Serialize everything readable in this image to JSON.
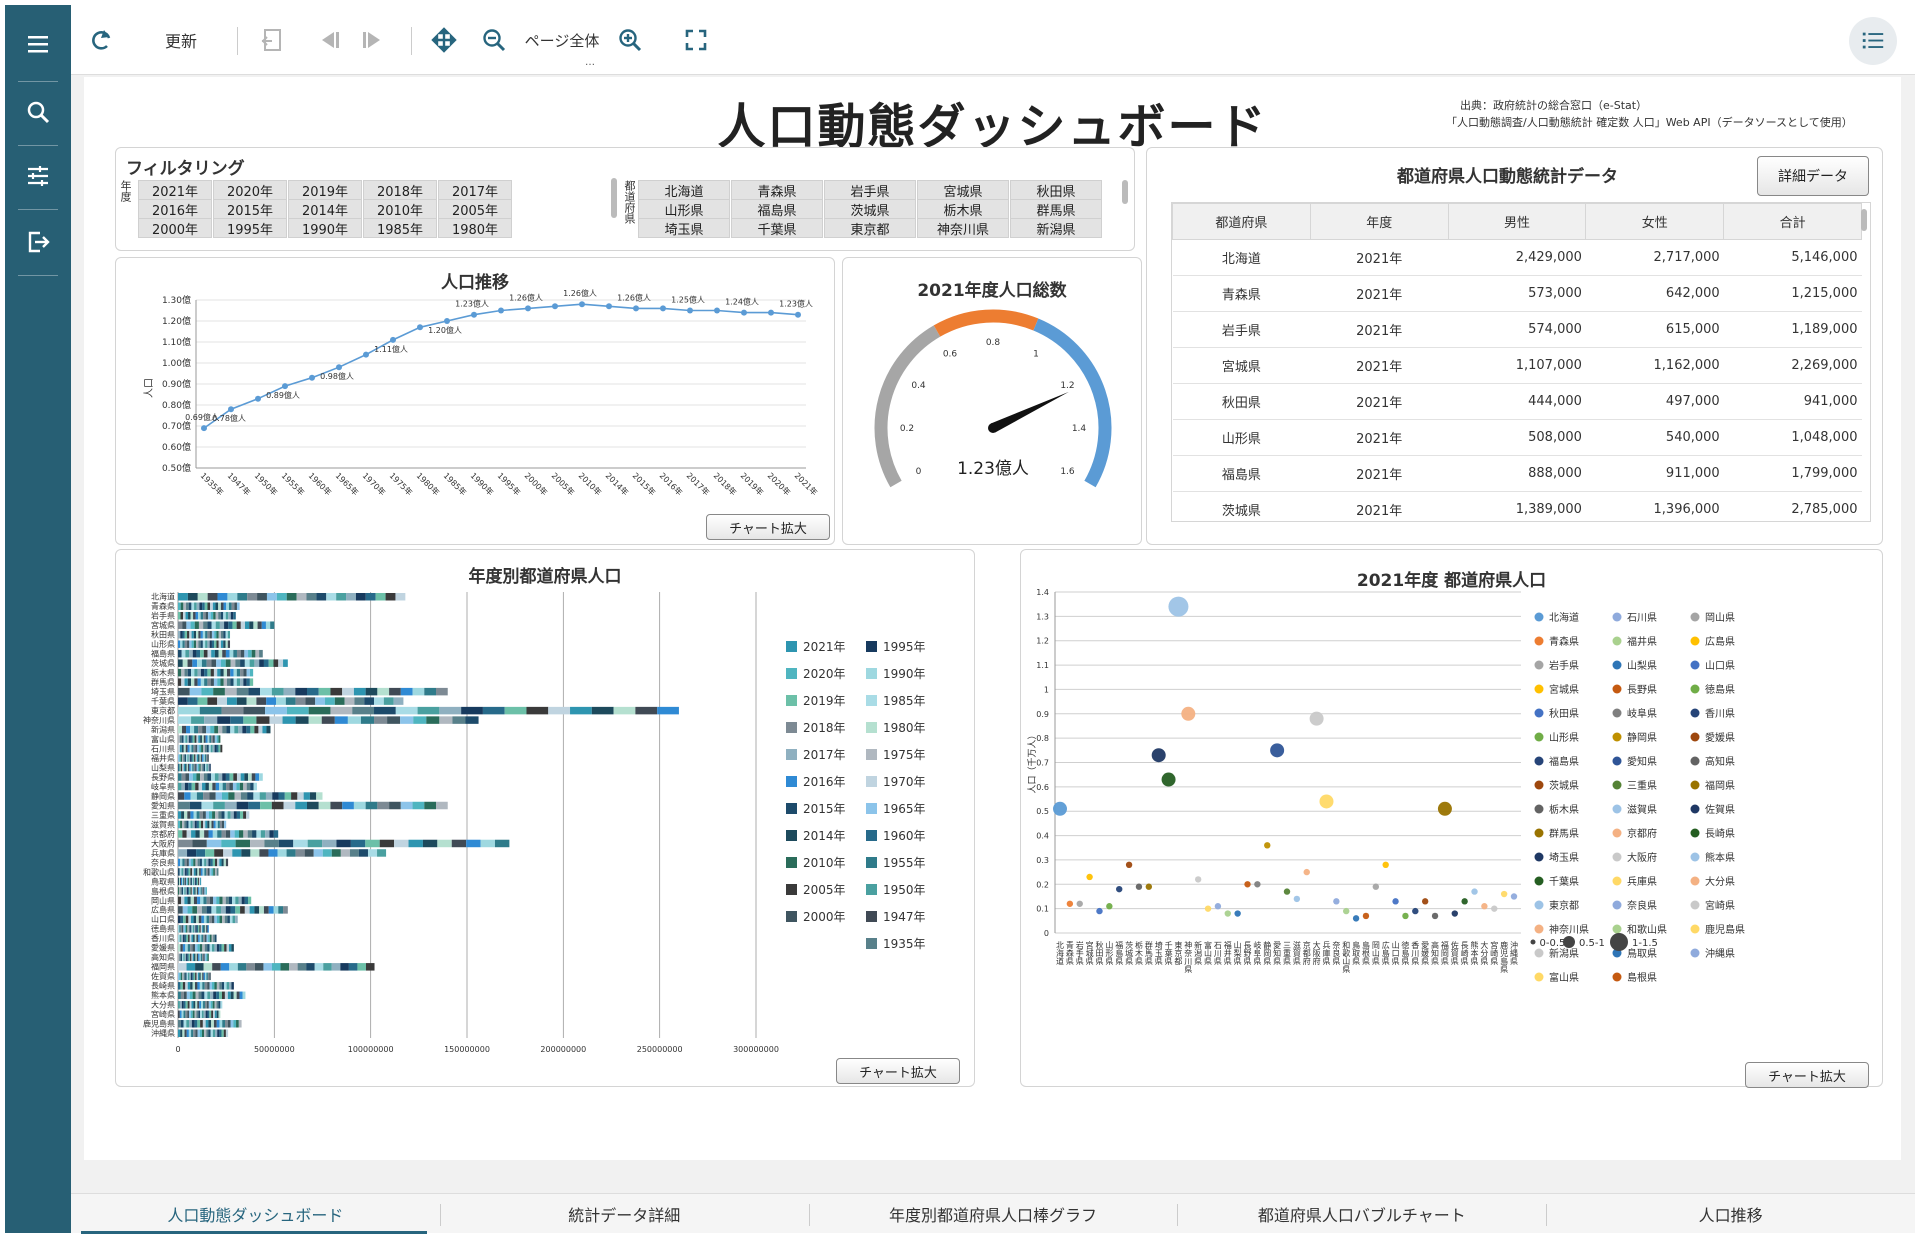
{
  "toolbar": {
    "refresh_label": "更新",
    "page_fit_label": "ページ全体"
  },
  "dashboard": {
    "title": "人口動態ダッシュボード",
    "source_line1": "出典：政府統計の総合窓口（e-Stat）",
    "source_line2": "「人口動態調査/人口動態統計 確定数 人口」Web API（データソースとして使用）"
  },
  "filter": {
    "title": "フィルタリング",
    "year_label": "年度",
    "pref_label": "都道府県",
    "years": [
      "2021年",
      "2020年",
      "2019年",
      "2018年",
      "2017年",
      "2016年",
      "2015年",
      "2014年",
      "2010年",
      "2005年",
      "2000年",
      "1995年",
      "1990年",
      "1985年",
      "1980年"
    ],
    "prefs": [
      "北海道",
      "青森県",
      "岩手県",
      "宮城県",
      "秋田県",
      "山形県",
      "福島県",
      "茨城県",
      "栃木県",
      "群馬県",
      "埼玉県",
      "千葉県",
      "東京都",
      "神奈川県",
      "新潟県"
    ]
  },
  "line_panel": {
    "title": "人口推移",
    "ylabel": "人口",
    "expand_label": "チャート拡大"
  },
  "gauge_panel": {
    "title": "2021年度人口総数",
    "value_label": "1.23億人",
    "value": 1.23,
    "min": 0,
    "max": 1.6,
    "ticks": [
      "0",
      "0.2",
      "0.4",
      "0.6",
      "0.8",
      "1",
      "1.2",
      "1.4",
      "1.6"
    ],
    "colors": {
      "low": "#a6a6a6",
      "mid": "#ed7d31",
      "high": "#5b9bd5"
    }
  },
  "table_panel": {
    "title": "都道府県人口動態統計データ",
    "detail_label": "詳細データ",
    "headers": [
      "都道府県",
      "年度",
      "男性",
      "女性",
      "合計"
    ],
    "rows": [
      [
        "北海道",
        "2021年",
        "2,429,000",
        "2,717,000",
        "5,146,000"
      ],
      [
        "青森県",
        "2021年",
        "573,000",
        "642,000",
        "1,215,000"
      ],
      [
        "岩手県",
        "2021年",
        "574,000",
        "615,000",
        "1,189,000"
      ],
      [
        "宮城県",
        "2021年",
        "1,107,000",
        "1,162,000",
        "2,269,000"
      ],
      [
        "秋田県",
        "2021年",
        "444,000",
        "497,000",
        "941,000"
      ],
      [
        "山形県",
        "2021年",
        "508,000",
        "540,000",
        "1,048,000"
      ],
      [
        "福島県",
        "2021年",
        "888,000",
        "911,000",
        "1,799,000"
      ],
      [
        "茨城県",
        "2021年",
        "1,389,000",
        "1,396,000",
        "2,785,000"
      ]
    ]
  },
  "bar_panel": {
    "title": "年度別都道府県人口",
    "expand_label": "チャート拡大"
  },
  "bubble_panel": {
    "title": "2021年度 都道府県人口",
    "ylabel": "人口（千万人）",
    "expand_label": "チャート拡大",
    "size_legend": [
      "0-0.5",
      "0.5-1",
      "1-1.5"
    ]
  },
  "bottom_tabs": [
    "人口動態ダッシュボード",
    "統計データ詳細",
    "年度別都道府県人口棒グラフ",
    "都道府県人口バブルチャート",
    "人口推移"
  ],
  "chart_data": [
    {
      "type": "line",
      "title": "人口推移",
      "ylabel": "人口",
      "x": [
        "1935年",
        "1947年",
        "1950年",
        "1955年",
        "1960年",
        "1965年",
        "1970年",
        "1975年",
        "1980年",
        "1985年",
        "1990年",
        "1995年",
        "2000年",
        "2005年",
        "2010年",
        "2014年",
        "2015年",
        "2016年",
        "2017年",
        "2018年",
        "2019年",
        "2020年",
        "2021年"
      ],
      "values": [
        0.69,
        0.78,
        0.83,
        0.89,
        0.93,
        0.98,
        1.04,
        1.11,
        1.17,
        1.2,
        1.23,
        1.25,
        1.26,
        1.27,
        1.28,
        1.27,
        1.26,
        1.26,
        1.25,
        1.25,
        1.24,
        1.24,
        1.23
      ],
      "data_labels": {
        "0": "0.69億人",
        "1": "0.78億人",
        "3": "0.89億人",
        "5": "0.98億人",
        "7": "1.11億人",
        "9": "1.20億人",
        "10": "1.23億人",
        "12": "1.26億人",
        "14": "1.26億人",
        "16": "1.26億人",
        "18": "1.25億人",
        "20": "1.24億人",
        "22": "1.23億人"
      },
      "yticks": [
        "0.50億",
        "0.60億",
        "0.70億",
        "0.80億",
        "0.90億",
        "1.00億",
        "1.10億",
        "1.20億",
        "1.30億"
      ],
      "ylim": [
        0.5,
        1.3
      ],
      "color": "#5b9bd5"
    },
    {
      "type": "bar",
      "title": "年度別都道府県人口",
      "orientation": "horizontal",
      "stacked": true,
      "categories": [
        "北海道",
        "青森県",
        "岩手県",
        "宮城県",
        "秋田県",
        "山形県",
        "福島県",
        "茨城県",
        "栃木県",
        "群馬県",
        "埼玉県",
        "千葉県",
        "東京都",
        "神奈川県",
        "新潟県",
        "富山県",
        "石川県",
        "福井県",
        "山梨県",
        "長野県",
        "岐阜県",
        "静岡県",
        "愛知県",
        "三重県",
        "滋賀県",
        "京都府",
        "大阪府",
        "兵庫県",
        "奈良県",
        "和歌山県",
        "鳥取県",
        "島根県",
        "岡山県",
        "広島県",
        "山口県",
        "徳島県",
        "香川県",
        "愛媛県",
        "高知県",
        "福岡県",
        "佐賀県",
        "長崎県",
        "熊本県",
        "大分県",
        "宮崎県",
        "鹿児島県",
        "沖縄県"
      ],
      "totals": [
        118000000,
        32000000,
        30000000,
        50000000,
        27000000,
        27000000,
        44000000,
        57000000,
        39000000,
        39000000,
        140000000,
        117000000,
        260000000,
        156000000,
        48000000,
        22000000,
        23000000,
        16000000,
        17000000,
        44000000,
        41000000,
        75000000,
        140000000,
        37000000,
        25000000,
        52000000,
        172000000,
        108000000,
        26000000,
        21000000,
        12000000,
        15000000,
        38000000,
        57000000,
        31000000,
        16000000,
        20000000,
        29000000,
        16000000,
        102000000,
        17000000,
        29000000,
        35000000,
        23000000,
        22000000,
        33000000,
        26000000
      ],
      "xticks": [
        "0",
        "50000000",
        "100000000",
        "150000000",
        "200000000",
        "250000000",
        "300000000"
      ],
      "xlim": [
        0,
        300000000
      ],
      "legend": [
        "2021年",
        "2020年",
        "2019年",
        "2018年",
        "2017年",
        "2016年",
        "2015年",
        "2014年",
        "2010年",
        "2005年",
        "2000年",
        "1995年",
        "1990年",
        "1985年",
        "1980年",
        "1975年",
        "1970年",
        "1965年",
        "1960年",
        "1955年",
        "1950年",
        "1947年",
        "1935年"
      ],
      "legend_colors": [
        "#2e95b0",
        "#4fb5c0",
        "#6cc0a8",
        "#7d8a94",
        "#8fb0c0",
        "#2f8ad4",
        "#1d4b6b",
        "#1d4a5c",
        "#2a6c5a",
        "#3a3a3a",
        "#3f5560",
        "#173a5e",
        "#9ed8e0",
        "#a9dce6",
        "#b5e0d0",
        "#b0b8c0",
        "#c0d4e0",
        "#8cc4ea",
        "#276a8a",
        "#2f7b8a",
        "#4aa0a0",
        "#404a55",
        "#58808a"
      ]
    },
    {
      "type": "scatter",
      "title": "2021年度 都道府県人口",
      "ylabel": "人口（千万人）",
      "yticks": [
        "0",
        "0.1",
        "0.2",
        "0.3",
        "0.4",
        "0.5",
        "0.6",
        "0.7",
        "0.8",
        "0.9",
        "1",
        "1.1",
        "1.2",
        "1.3",
        "1.4"
      ],
      "ylim": [
        0,
        1.4
      ],
      "x": [
        "北海道",
        "青森県",
        "岩手県",
        "宮城県",
        "秋田県",
        "山形県",
        "福島県",
        "茨城県",
        "栃木県",
        "群馬県",
        "埼玉県",
        "千葉県",
        "東京都",
        "神奈川県",
        "新潟県",
        "富山県",
        "石川県",
        "福井県",
        "山梨県",
        "長野県",
        "岐阜県",
        "静岡県",
        "愛知県",
        "三重県",
        "滋賀県",
        "京都府",
        "大阪府",
        "兵庫県",
        "奈良県",
        "和歌山県",
        "鳥取県",
        "島根県",
        "岡山県",
        "広島県",
        "山口県",
        "徳島県",
        "香川県",
        "愛媛県",
        "高知県",
        "福岡県",
        "佐賀県",
        "長崎県",
        "熊本県",
        "大分県",
        "宮崎県",
        "鹿児島県",
        "沖縄県"
      ],
      "values": [
        0.51,
        0.12,
        0.12,
        0.23,
        0.09,
        0.11,
        0.18,
        0.28,
        0.19,
        0.19,
        0.73,
        0.63,
        1.34,
        0.9,
        0.22,
        0.1,
        0.11,
        0.08,
        0.08,
        0.2,
        0.2,
        0.36,
        0.75,
        0.17,
        0.14,
        0.25,
        0.88,
        0.54,
        0.13,
        0.09,
        0.06,
        0.07,
        0.19,
        0.28,
        0.13,
        0.07,
        0.09,
        0.13,
        0.07,
        0.51,
        0.08,
        0.13,
        0.17,
        0.11,
        0.1,
        0.16,
        0.15
      ],
      "colors": [
        "#5b9bd5",
        "#ed7d31",
        "#a5a5a5",
        "#ffc000",
        "#4472c4",
        "#70ad47",
        "#264478",
        "#9e480e",
        "#636363",
        "#997300",
        "#1f3864",
        "#255e22",
        "#9dc3e6",
        "#f4b183",
        "#c9c9c9",
        "#ffd966",
        "#8faadc",
        "#a9d18e",
        "#2e75b6",
        "#c55a11",
        "#7f7f7f",
        "#bf9000",
        "#2f5597",
        "#548235",
        "#9dc3e6",
        "#f4b183",
        "#c9c9c9",
        "#ffd966",
        "#8faadc",
        "#a9d18e",
        "#2e75b6",
        "#c55a11",
        "#a5a5a5",
        "#ffc000",
        "#4472c4",
        "#70ad47",
        "#264478",
        "#9e480e",
        "#636363",
        "#997300",
        "#1f3864",
        "#255e22",
        "#9dc3e6",
        "#f4b183",
        "#c9c9c9",
        "#ffd966",
        "#8faadc"
      ]
    }
  ]
}
